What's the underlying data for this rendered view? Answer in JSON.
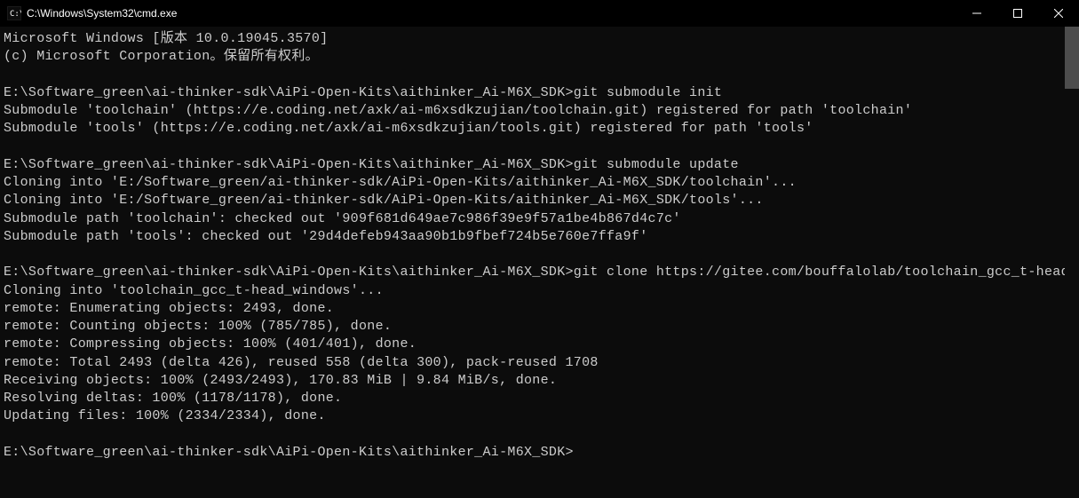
{
  "titlebar": {
    "title": "C:\\Windows\\System32\\cmd.exe"
  },
  "terminal": {
    "lines": [
      "Microsoft Windows [版本 10.0.19045.3570]",
      "(c) Microsoft Corporation。保留所有权利。",
      "",
      "E:\\Software_green\\ai-thinker-sdk\\AiPi-Open-Kits\\aithinker_Ai-M6X_SDK>git submodule init",
      "Submodule 'toolchain' (https://e.coding.net/axk/ai-m6xsdkzujian/toolchain.git) registered for path 'toolchain'",
      "Submodule 'tools' (https://e.coding.net/axk/ai-m6xsdkzujian/tools.git) registered for path 'tools'",
      "",
      "E:\\Software_green\\ai-thinker-sdk\\AiPi-Open-Kits\\aithinker_Ai-M6X_SDK>git submodule update",
      "Cloning into 'E:/Software_green/ai-thinker-sdk/AiPi-Open-Kits/aithinker_Ai-M6X_SDK/toolchain'...",
      "Cloning into 'E:/Software_green/ai-thinker-sdk/AiPi-Open-Kits/aithinker_Ai-M6X_SDK/tools'...",
      "Submodule path 'toolchain': checked out '909f681d649ae7c986f39e9f57a1be4b867d4c7c'",
      "Submodule path 'tools': checked out '29d4defeb943aa90b1b9fbef724b5e760e7ffa9f'",
      "",
      "E:\\Software_green\\ai-thinker-sdk\\AiPi-Open-Kits\\aithinker_Ai-M6X_SDK>git clone https://gitee.com/bouffalolab/toolchain_gcc_t-head_windows.git",
      "Cloning into 'toolchain_gcc_t-head_windows'...",
      "remote: Enumerating objects: 2493, done.",
      "remote: Counting objects: 100% (785/785), done.",
      "remote: Compressing objects: 100% (401/401), done.",
      "remote: Total 2493 (delta 426), reused 558 (delta 300), pack-reused 1708",
      "Receiving objects: 100% (2493/2493), 170.83 MiB | 9.84 MiB/s, done.",
      "Resolving deltas: 100% (1178/1178), done.",
      "Updating files: 100% (2334/2334), done.",
      "",
      "E:\\Software_green\\ai-thinker-sdk\\AiPi-Open-Kits\\aithinker_Ai-M6X_SDK>"
    ]
  }
}
